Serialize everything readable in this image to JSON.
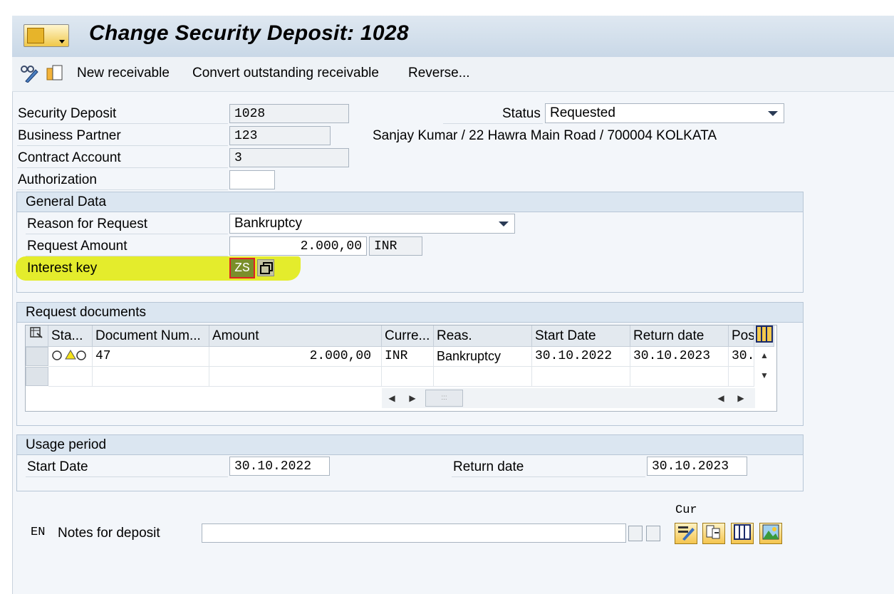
{
  "title": "Change Security Deposit: 1028",
  "toolbar": {
    "new_receivable": "New receivable",
    "convert": "Convert outstanding receivable",
    "reverse": "Reverse..."
  },
  "header": {
    "security_deposit_label": "Security Deposit",
    "security_deposit_value": "1028",
    "business_partner_label": "Business Partner",
    "business_partner_value": "123",
    "business_partner_text": "Sanjay Kumar / 22 Hawra Main Road / 700004 KOLKATA",
    "contract_account_label": "Contract Account",
    "contract_account_value": "3",
    "authorization_label": "Authorization",
    "authorization_value": "",
    "status_label": "Status",
    "status_value": "Requested"
  },
  "general_data": {
    "heading": "General Data",
    "reason_label": "Reason for Request",
    "reason_value": "Bankruptcy",
    "amount_label": "Request Amount",
    "amount_value": "2.000,00",
    "currency_value": "INR",
    "interest_label": "Interest key",
    "interest_value": "ZS"
  },
  "request_documents": {
    "heading": "Request documents",
    "columns": [
      "Sta...",
      "Document Num...",
      "Amount",
      "Curre...",
      "Reas.",
      "Start Date",
      "Return date",
      "Pos"
    ],
    "rows": [
      {
        "document": "47",
        "amount": "2.000,00",
        "currency": "INR",
        "reason": "Bankruptcy",
        "start": "30.10.2022",
        "return": "30.10.2023",
        "pos": "30."
      }
    ]
  },
  "usage_period": {
    "heading": "Usage period",
    "start_label": "Start Date",
    "start_value": "30.10.2022",
    "return_label": "Return date",
    "return_value": "30.10.2023"
  },
  "notes": {
    "lang": "EN",
    "label": "Notes for deposit",
    "value": "",
    "cur_label": "Cur"
  },
  "colors": {
    "highlight": "#e4ec2c",
    "group_header": "#dbe6f1",
    "title_bar": "#c9d8e7"
  }
}
